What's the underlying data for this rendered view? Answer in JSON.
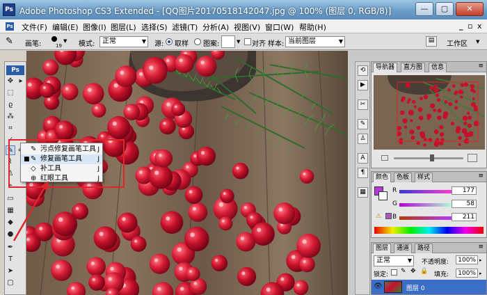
{
  "window": {
    "title": "Adobe Photoshop CS3 Extended - [QQ图片20170518142047.jpg @ 100% (图层 0, RGB/8)]",
    "app_badge": "Ps",
    "minimize": "—",
    "maximize": "▢",
    "close": "✕"
  },
  "menu": {
    "items": [
      "文件(F)",
      "编辑(E)",
      "图像(I)",
      "图层(L)",
      "选择(S)",
      "滤镜(T)",
      "分析(A)",
      "视图(V)",
      "窗口(W)",
      "帮助(H)"
    ],
    "doc_min": "_",
    "doc_restore": "▫",
    "doc_close": "x"
  },
  "options": {
    "brush_label": "画笔:",
    "brush_size": "19",
    "mode_label": "模式:",
    "mode_value": "正常",
    "source_label": "源:",
    "sampled_label": "取样",
    "pattern_label": "图案:",
    "aligned_label": "对齐",
    "sample_label": "样本:",
    "sample_value": "当前图层",
    "workspace_label": "工作区"
  },
  "toolbox": {
    "badge": "Ps"
  },
  "flyout": {
    "items": [
      {
        "label": "污点修复画笔工具",
        "key": "J",
        "icon": "spot-healing-brush-icon",
        "active": false
      },
      {
        "label": "修复画笔工具",
        "key": "J",
        "icon": "healing-brush-icon",
        "active": true
      },
      {
        "label": "补工具",
        "key": "J",
        "icon": "patch-icon",
        "active": false
      },
      {
        "label": "红眼工具",
        "key": "J",
        "icon": "red-eye-icon",
        "active": false
      }
    ]
  },
  "navigator": {
    "tabs": [
      "导航器",
      "直方图",
      "信息"
    ]
  },
  "color": {
    "tabs": [
      "颜色",
      "色板",
      "样式"
    ],
    "r_label": "R",
    "r_value": "177",
    "g_label": "G",
    "g_value": "58",
    "b_label": "B",
    "b_value": "211",
    "swatch": "#b13ad3"
  },
  "layers": {
    "tabs": [
      "图层",
      "通道",
      "路径"
    ],
    "blend_mode": "正常",
    "opacity_label": "不透明度:",
    "opacity_value": "100%",
    "lock_label": "锁定:",
    "fill_label": "填充:",
    "fill_value": "100%",
    "layer_name": "图层 0"
  },
  "colors": {
    "highlight": "#e0252a",
    "selection": "#3b6ec6"
  }
}
